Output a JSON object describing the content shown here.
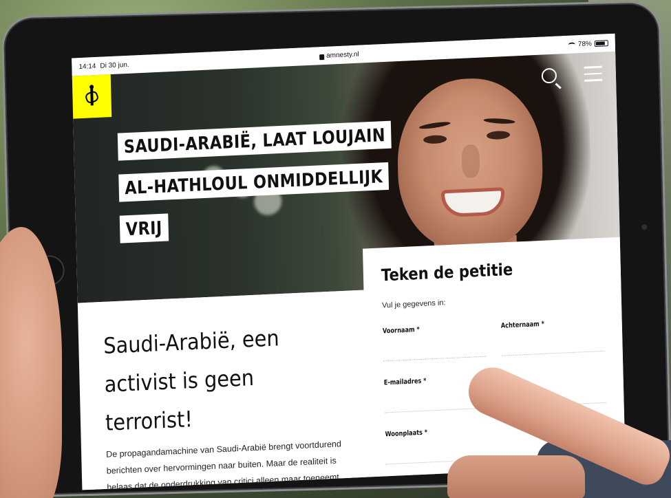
{
  "status": {
    "time": "14:14",
    "date": "Di 30 jun.",
    "url": "amnesty.nl",
    "battery": "78%"
  },
  "hero": {
    "headline_lines": [
      "SAUDI-ARABIË, LAAT LOUJAIN",
      "AL-HATHLOUL ONMIDDELLIJK",
      "VRIJ"
    ]
  },
  "article": {
    "title": "Saudi-Arabië, een activist is geen terrorist!",
    "text": "De propagandamachine van Saudi-Arabië brengt voortdurend berichten over hervormingen naar buiten. Maar de realiteit is helaas dat de onderdrukking van critici alleen maar toeneemt."
  },
  "petition": {
    "title": "Teken de petitie",
    "subtitle": "Vul je gegevens in:",
    "first_name_label": "Voornaam *",
    "last_name_label": "Achternaam *",
    "email_label": "E-mailadres *",
    "city_label": "Woonplaats *"
  },
  "colors": {
    "brand_yellow": "#ffff00"
  },
  "icons": [
    "lock-icon",
    "wifi-icon",
    "battery-icon",
    "search-icon",
    "menu-icon",
    "amnesty-candle-icon"
  ]
}
